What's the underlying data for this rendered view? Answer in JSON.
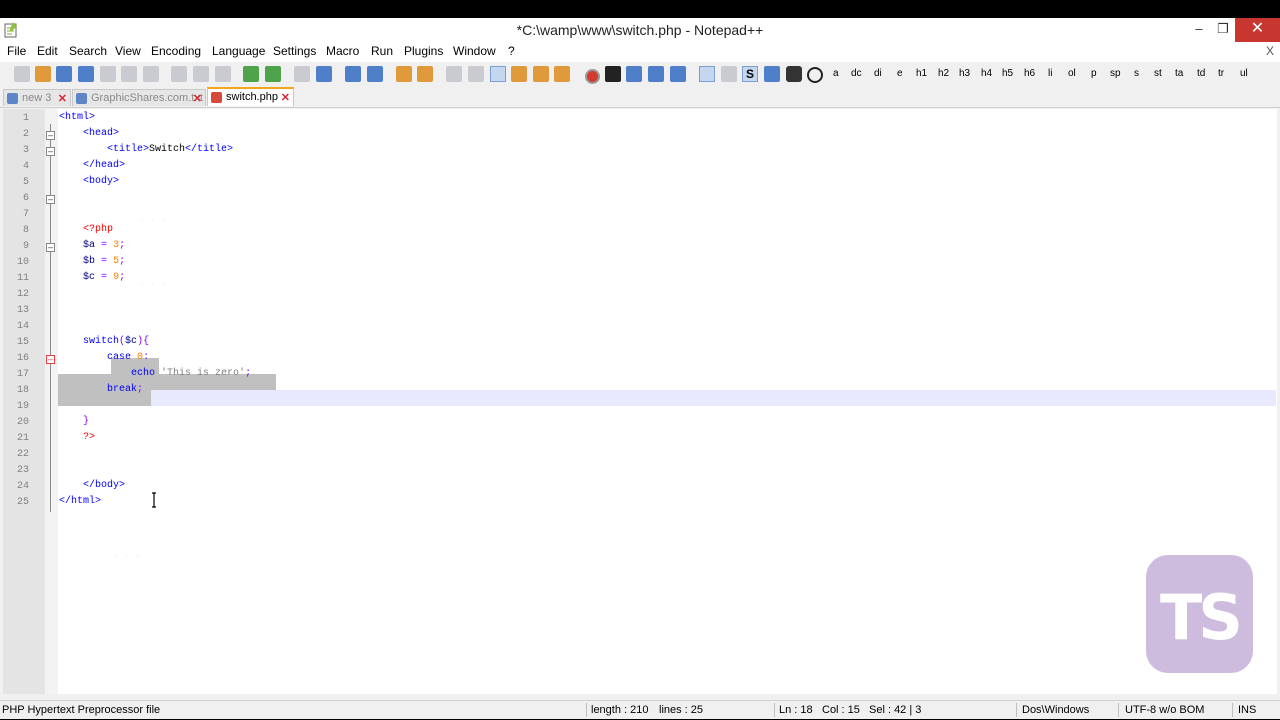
{
  "window": {
    "title": "*C:\\wamp\\www\\switch.php - Notepad++"
  },
  "menu": [
    "File",
    "Edit",
    "Search",
    "View",
    "Encoding",
    "Language",
    "Settings",
    "Macro",
    "Run",
    "Plugins",
    "Window",
    "?"
  ],
  "menu_close": "X",
  "toolbar": {
    "icons": [
      "new-icon",
      "open-icon",
      "save-icon",
      "save-all-icon",
      "close-icon",
      "close-all-icon",
      "print-icon",
      "cut-icon",
      "copy-icon",
      "paste-icon",
      "undo-icon",
      "redo-icon",
      "find-icon",
      "replace-icon",
      "zoom-in-icon",
      "zoom-out-icon",
      "sync-v-icon",
      "sync-h-icon",
      "word-wrap-icon",
      "show-all-chars-icon",
      "indent-guide-icon",
      "doc-map-icon",
      "folder-icon",
      "function-list-icon",
      "macro-record-icon",
      "macro-stop-icon",
      "macro-play-icon",
      "macro-run-multiple-icon",
      "macro-save-icon",
      "spell-check-icon",
      "spell-options-icon",
      "s-plugin-icon",
      "plugin-icon",
      "binoculars-icon",
      "target-icon"
    ],
    "html_tags": [
      "a",
      "dc",
      "di",
      "e",
      "h1",
      "h2",
      "h3",
      "h4",
      "h5",
      "h6",
      "li",
      "ol",
      "p",
      "sp",
      "s",
      "st",
      "ta",
      "td",
      "tr",
      "ul"
    ]
  },
  "tabs": [
    {
      "label": "new 3",
      "active": false
    },
    {
      "label": "GraphicShares.com.txt",
      "active": false
    },
    {
      "label": "switch.php",
      "active": true
    }
  ],
  "editor": {
    "lines": [
      {
        "n": "1",
        "code": [
          [
            "tag",
            "<html>"
          ]
        ]
      },
      {
        "n": "2",
        "code": [
          [
            "plain",
            "    "
          ],
          [
            "tag",
            "<head>"
          ]
        ]
      },
      {
        "n": "3",
        "code": [
          [
            "plain",
            "        "
          ],
          [
            "tag",
            "<title>"
          ],
          [
            "plain",
            "Switch"
          ],
          [
            "tag",
            "</title>"
          ]
        ]
      },
      {
        "n": "4",
        "code": [
          [
            "plain",
            "    "
          ],
          [
            "tag",
            "</head>"
          ]
        ]
      },
      {
        "n": "5",
        "code": [
          [
            "plain",
            "    "
          ],
          [
            "tag",
            "<body>"
          ]
        ]
      },
      {
        "n": "6",
        "code": []
      },
      {
        "n": "7",
        "code": []
      },
      {
        "n": "8",
        "code": [
          [
            "plain",
            "    "
          ],
          [
            "php",
            "<?php"
          ]
        ]
      },
      {
        "n": "9",
        "code": [
          [
            "plain",
            "    "
          ],
          [
            "var",
            "$a"
          ],
          [
            "plain",
            " "
          ],
          [
            "op",
            "="
          ],
          [
            "plain",
            " "
          ],
          [
            "num",
            "3"
          ],
          [
            "op",
            ";"
          ]
        ]
      },
      {
        "n": "10",
        "code": [
          [
            "plain",
            "    "
          ],
          [
            "var",
            "$b"
          ],
          [
            "plain",
            " "
          ],
          [
            "op",
            "="
          ],
          [
            "plain",
            " "
          ],
          [
            "num",
            "5"
          ],
          [
            "op",
            ";"
          ]
        ]
      },
      {
        "n": "11",
        "code": [
          [
            "plain",
            "    "
          ],
          [
            "var",
            "$c"
          ],
          [
            "plain",
            " "
          ],
          [
            "op",
            "="
          ],
          [
            "plain",
            " "
          ],
          [
            "num",
            "9"
          ],
          [
            "op",
            ";"
          ]
        ]
      },
      {
        "n": "12",
        "code": []
      },
      {
        "n": "13",
        "code": []
      },
      {
        "n": "14",
        "code": []
      },
      {
        "n": "15",
        "code": [
          [
            "plain",
            "    "
          ],
          [
            "kw",
            "switch"
          ],
          [
            "op",
            "("
          ],
          [
            "var",
            "$c"
          ],
          [
            "op",
            "){"
          ]
        ]
      },
      {
        "n": "16",
        "code": [
          [
            "plain",
            "        "
          ],
          [
            "kw",
            "case"
          ],
          [
            "plain",
            " "
          ],
          [
            "num",
            "0"
          ],
          [
            "op",
            ":"
          ]
        ]
      },
      {
        "n": "17",
        "code": [
          [
            "plain",
            "            "
          ],
          [
            "kw",
            "echo"
          ],
          [
            "plain",
            " "
          ],
          [
            "str",
            "'This is zero'"
          ],
          [
            "op",
            ";"
          ]
        ]
      },
      {
        "n": "18",
        "code": [
          [
            "plain",
            "        "
          ],
          [
            "kw",
            "break"
          ],
          [
            "op",
            ";"
          ]
        ]
      },
      {
        "n": "19",
        "code": []
      },
      {
        "n": "20",
        "code": [
          [
            "plain",
            "    "
          ],
          [
            "op",
            "}"
          ]
        ]
      },
      {
        "n": "21",
        "code": [
          [
            "plain",
            "    "
          ],
          [
            "php",
            "?>"
          ]
        ]
      },
      {
        "n": "22",
        "code": []
      },
      {
        "n": "23",
        "code": []
      },
      {
        "n": "24",
        "code": [
          [
            "plain",
            "    "
          ],
          [
            "tag",
            "</body>"
          ]
        ]
      },
      {
        "n": "25",
        "code": [
          [
            "tag",
            "</html>"
          ]
        ]
      }
    ]
  },
  "watermark": "TS",
  "status": {
    "file_type": "PHP Hypertext Preprocessor file",
    "length": "length : 210",
    "lines": "lines : 25",
    "ln": "Ln : 18",
    "col": "Col : 15",
    "sel": "Sel : 42 | 3",
    "eol": "Dos\\Windows",
    "encoding": "UTF-8 w/o BOM",
    "mode": "INS"
  },
  "colors": {
    "tag": "#0000ff",
    "php": "#ff0000",
    "number": "#ff8000",
    "string": "#808080",
    "selection": "#c0c0c0",
    "active_tab_accent": "#f7a41d",
    "watermark": "#c5b1d9"
  }
}
